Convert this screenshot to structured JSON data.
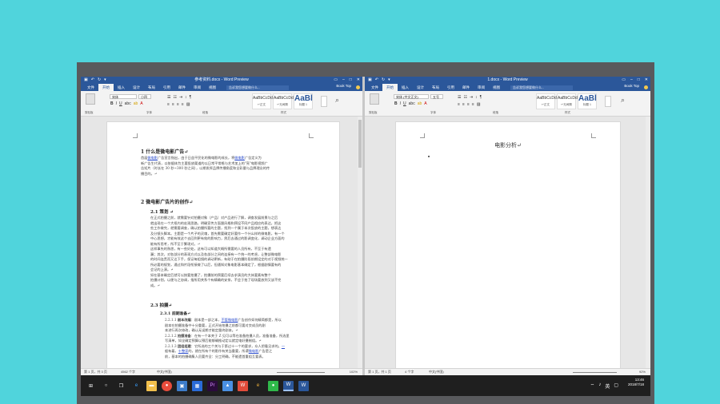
{
  "left_window": {
    "title": "参考资料.docx - Word Preview",
    "tabs": [
      "文件",
      "开始",
      "插入",
      "设计",
      "布局",
      "引用",
      "邮件",
      "审阅",
      "视图"
    ],
    "active_tab": "开始",
    "search_placeholder": "告诉我您想要做什么...",
    "user": "Book Top",
    "font_name": "宋体",
    "font_size": "小四",
    "styles": [
      {
        "preview": "AaBbCcDd",
        "label": "↵正文"
      },
      {
        "preview": "AaBbCcDd",
        "label": "↵无间隔"
      },
      {
        "preview": "AaBl",
        "label": "标题 1"
      }
    ],
    "group_labels": [
      "剪贴板",
      "字体",
      "段落",
      "样式"
    ],
    "status": {
      "page": "第 1 页，共 3 页",
      "words": "4562 个字",
      "lang": "中文(中国)",
      "zoom": "102%"
    },
    "doc": {
      "h1": "1  什么是微电影广告↵",
      "p1a": "首届",
      "p1link1": "微电影",
      "p1b": "广告宣言指出，由于日益平民化的微电影的成长，将",
      "p1link2": "微电影",
      "p1c": "广告定义为",
      "p1d": "新广告生代表，以依据体为主要投放渠道的以日常平常格与艺术加上的\"亮\"电影视频广",
      "p1e": "告短片（时长在 30 秒~300 秒之间），以期发挥品牌传播角度和全彩量与品牌理念的传",
      "p1f": "播目的。↵",
      "h2_heading": "2  微电影广告片的创作↵",
      "h2_link": "微电影",
      "s21": "2.1  策划 ↵",
      "s21p1": "在正式拍摄之前，就需要针对拍摄对象（产品）对产品进行了解，调查发展前景与之后",
      "s21p2": "就出现在一个大框内的宏观思路，明确宣传方面跟风格和预设不同产品相应的表达，把这",
      "s21p3": "些工作做完，就需要调查，确认拍摄所要的主题，找到一个属于本次投放的主题，想表达",
      "s21p4": "及分镜头脚本。主题是一个片子的灵魂，首先需要确定好要作一个什么样的微电影，有一个",
      "s21p5": "中心思想，才能有效这个去回到更有效的影响力，然后去通过的影调变化，调动企业方面的",
      "s21p6": "能有所思考，所不至于繁琐对。↵",
      "s21p7": "这样事先的熟悉，有一些好处，这有可以知道大概所需要的人员所有，不至于有遗",
      "s21p8": "漏；其次，对各部分的表现方式以及各部分之间的连接有一个统一的考虑，让整部微电影",
      "s21p9": "的时间连贯而又达下手，保证每组镜的调动更新，有助于在拍摄阶段前期设定的对于视频统一",
      "s21p10": "所必要的规划，通过和片段衔接做了以后，但通知对象电影基本确定了，根据剧情要有的",
      "s21p11": "会记的上演。↵",
      "s21p12": "如在基本确定后就可以按要拍摄了，拍摄前的预要后续去求演员的大体要素有整个",
      "s21p13": "拍摄计划，以便与之协调，指所用关系个有精确的安排，不会于拍了现场要放到又该不完",
      "s21p14": "成。↵",
      "s23": "2.3  拍摄↵",
      "s231": "2.3.1 前期准备↵",
      "s2311a": "2.2.1.1 ",
      "s2311b": "剧本改编",
      "s2311c": "：剧本是一部之本，",
      "s2311link": "不管微电影",
      "s2311d": "广告创作如何精简都是，所以",
      "s2311e": "剧本在拍摄准备中十分重要，正式开始拍摄之前都可要对交成员的剧",
      "s2311f": "本进行再次修改，确认无误期才能定量终剧本。↵",
      "s2312a": "2.2.1.2 ",
      "s2312b": "拍摄准备",
      "s2312c": "：在有一个本关于 Z 见可以等在准备拍摄人员，准备准备，所选里",
      "s2312d": "写清单，如全确定预算以预后能够确推动定以就定电好摄制组。↵",
      "s2313a": "2.2.1.3 ",
      "s2313b": "团组组建",
      "s2313c": "：它所选的三个关与于第过十一个的要求，众人把看见求的。",
      "s2313link1": "一",
      "s2313d": "般有着，",
      "s2313link2": "十整家",
      "s2313e": "的，就在所有个的影作有关当重要，所谓",
      "s2313link3": "微电影",
      "s2313f": "广告是之",
      "s2313g": "前，基本的拍摄确集人员要齐全：分工明确，不能遗首重组互要表。"
    }
  },
  "right_window": {
    "title": "1.docx - Word Preview",
    "tabs": [
      "文件",
      "开始",
      "插入",
      "设计",
      "布局",
      "引用",
      "邮件",
      "审阅",
      "视图"
    ],
    "active_tab": "开始",
    "search_placeholder": "告诉我您想要做什么...",
    "user": "Book Top",
    "font_name": "宋体 (中文正文)",
    "font_size": "五号",
    "styles": [
      {
        "preview": "AaBbCcDd",
        "label": "↵正文"
      },
      {
        "preview": "AaBbCcDd",
        "label": "↵无间隔"
      },
      {
        "preview": "AaBl",
        "label": "标题 1"
      }
    ],
    "group_labels": [
      "剪贴板",
      "字体",
      "段落",
      "样式"
    ],
    "status": {
      "page": "第 1 页，共 1 页",
      "words": "4 个字",
      "lang": "中文(中国)",
      "zoom": "92%"
    },
    "doc": {
      "h1": "电影分析↵"
    }
  },
  "taskbar": {
    "time": "13:46",
    "date": "2018/7/18",
    "icons": [
      "start-icon",
      "search-icon",
      "task-view-icon",
      "edge-icon",
      "explorer-icon",
      "chrome-icon",
      "app-icon",
      "store-icon",
      "premiere-icon",
      "photos-icon",
      "wps-icon",
      "ie-icon",
      "wechat-icon",
      "word-icon",
      "word2-icon"
    ]
  }
}
